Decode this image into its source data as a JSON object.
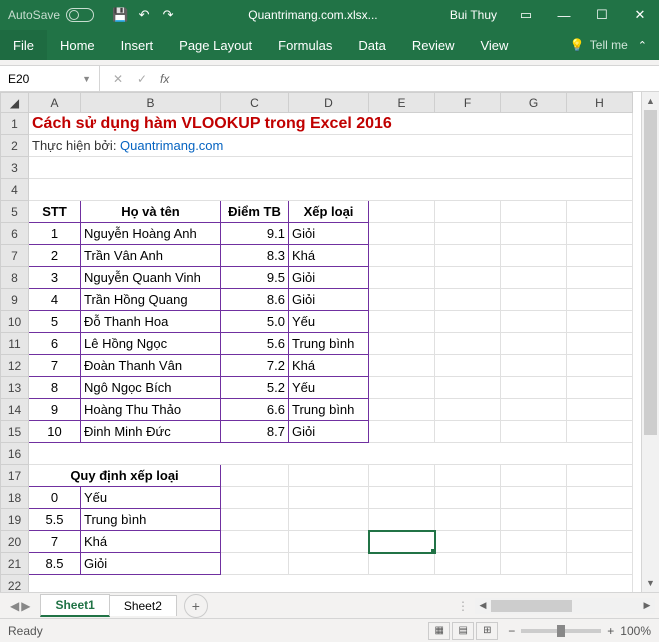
{
  "titlebar": {
    "autosave": "AutoSave",
    "filename": "Quantrimang.com.xlsx...",
    "user": "Bui Thuy"
  },
  "ribbon": {
    "file": "File",
    "tabs": [
      "Home",
      "Insert",
      "Page Layout",
      "Formulas",
      "Data",
      "Review",
      "View"
    ],
    "tellme": "Tell me"
  },
  "namebox": {
    "ref": "E20"
  },
  "cols": [
    "A",
    "B",
    "C",
    "D",
    "E",
    "F",
    "G",
    "H"
  ],
  "rows": [
    "1",
    "2",
    "3",
    "4",
    "5",
    "6",
    "7",
    "8",
    "9",
    "10",
    "11",
    "12",
    "13",
    "14",
    "15",
    "16",
    "17",
    "18",
    "19",
    "20",
    "21",
    "22"
  ],
  "title": "Cách sử dụng hàm VLOOKUP trong Excel 2016",
  "subtitle_prefix": "Thực hiện bởi: ",
  "subtitle_link": "Quantrimang.com",
  "headers1": {
    "stt": "STT",
    "hoten": "Họ và tên",
    "diemtb": "Điểm TB",
    "xeploai": "Xếp loại"
  },
  "table1": [
    {
      "stt": "1",
      "ten": "Nguyễn Hoàng Anh",
      "diem": "9.1",
      "xl": "Giỏi"
    },
    {
      "stt": "2",
      "ten": "Trần Vân Anh",
      "diem": "8.3",
      "xl": "Khá"
    },
    {
      "stt": "3",
      "ten": "Nguyễn Quanh Vinh",
      "diem": "9.5",
      "xl": "Giỏi"
    },
    {
      "stt": "4",
      "ten": "Trần Hồng Quang",
      "diem": "8.6",
      "xl": "Giỏi"
    },
    {
      "stt": "5",
      "ten": "Đỗ Thanh Hoa",
      "diem": "5.0",
      "xl": "Yếu"
    },
    {
      "stt": "6",
      "ten": "Lê Hồng Ngọc",
      "diem": "5.6",
      "xl": "Trung bình"
    },
    {
      "stt": "7",
      "ten": "Đoàn Thanh Vân",
      "diem": "7.2",
      "xl": "Khá"
    },
    {
      "stt": "8",
      "ten": "Ngô Ngọc Bích",
      "diem": "5.2",
      "xl": "Yếu"
    },
    {
      "stt": "9",
      "ten": "Hoàng Thu Thảo",
      "diem": "6.6",
      "xl": "Trung bình"
    },
    {
      "stt": "10",
      "ten": "Đinh Minh Đức",
      "diem": "8.7",
      "xl": "Giỏi"
    }
  ],
  "header2": "Quy định xếp loại",
  "table2": [
    {
      "min": "0",
      "xl": "Yếu"
    },
    {
      "min": "5.5",
      "xl": "Trung bình"
    },
    {
      "min": "7",
      "xl": "Khá"
    },
    {
      "min": "8.5",
      "xl": "Giỏi"
    }
  ],
  "sheets": {
    "s1": "Sheet1",
    "s2": "Sheet2"
  },
  "status": {
    "ready": "Ready",
    "zoom": "100%"
  }
}
